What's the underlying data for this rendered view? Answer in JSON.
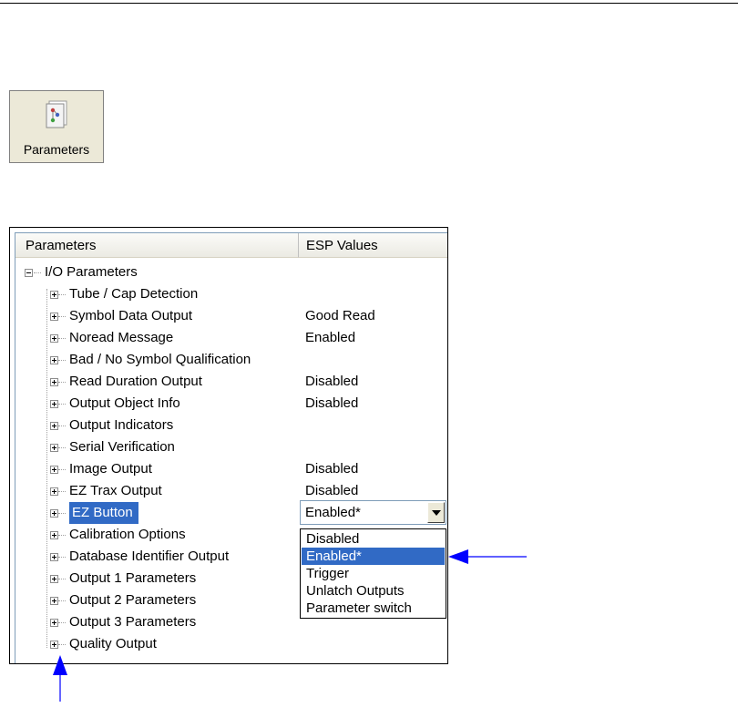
{
  "button": {
    "label": "Parameters",
    "icon": "parameters-doc-icon"
  },
  "tree": {
    "columns": [
      "Parameters",
      "ESP Values"
    ],
    "root": "I/O Parameters",
    "items": [
      {
        "label": "Tube / Cap Detection",
        "value": ""
      },
      {
        "label": "Symbol Data Output",
        "value": "Good Read"
      },
      {
        "label": "Noread Message",
        "value": "Enabled"
      },
      {
        "label": "Bad / No Symbol Qualification",
        "value": ""
      },
      {
        "label": "Read Duration Output",
        "value": "Disabled"
      },
      {
        "label": "Output Object Info",
        "value": "Disabled"
      },
      {
        "label": "Output Indicators",
        "value": ""
      },
      {
        "label": "Serial Verification",
        "value": ""
      },
      {
        "label": "Image Output",
        "value": "Disabled"
      },
      {
        "label": "EZ Trax Output",
        "value": "Disabled"
      },
      {
        "label": "EZ Button",
        "value": ""
      },
      {
        "label": "Calibration Options",
        "value": ""
      },
      {
        "label": "Database Identifier Output",
        "value": ""
      },
      {
        "label": "Output 1 Parameters",
        "value": ""
      },
      {
        "label": "Output 2 Parameters",
        "value": ""
      },
      {
        "label": "Output 3 Parameters",
        "value": ""
      },
      {
        "label": "Quality Output",
        "value": ""
      }
    ],
    "selected_item": "EZ Button"
  },
  "combo": {
    "value": "Enabled*",
    "options": [
      "Disabled",
      "Enabled*",
      "Trigger",
      "Unlatch Outputs",
      "Parameter switch"
    ],
    "highlighted": "Enabled*"
  },
  "colors": {
    "selection": "#316ac5",
    "arrow": "#0000ff"
  }
}
